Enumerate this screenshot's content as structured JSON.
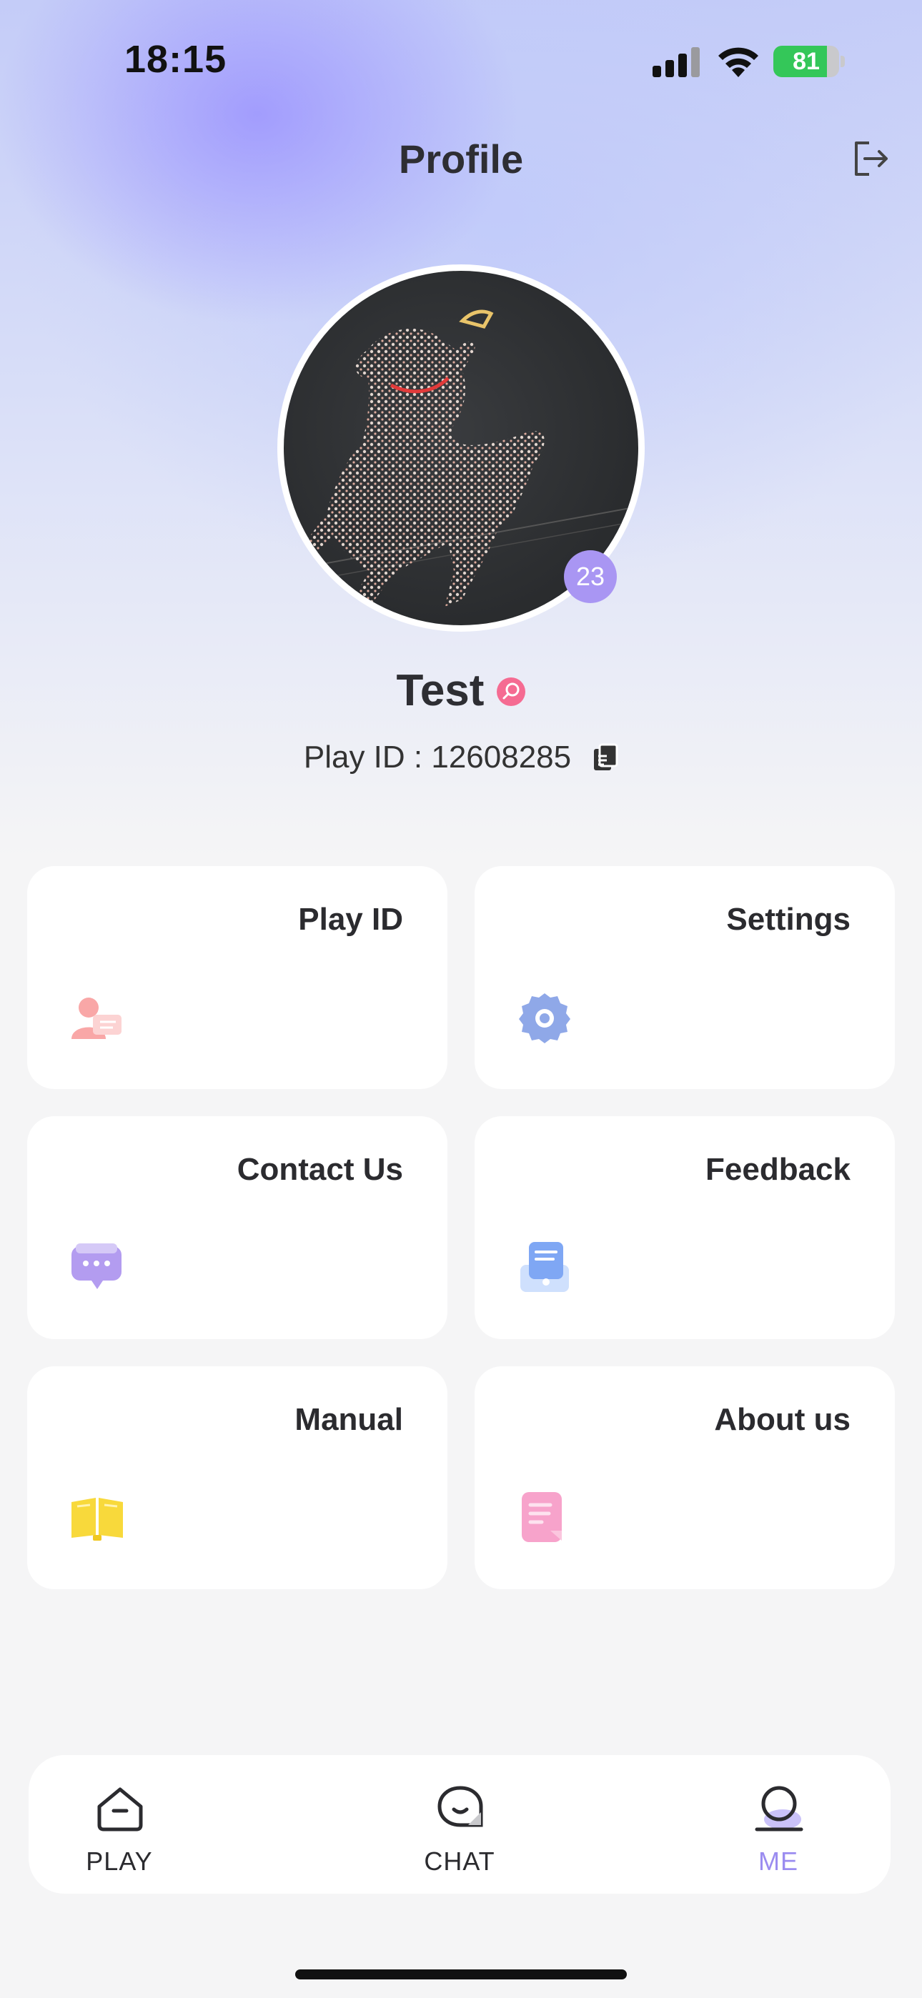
{
  "status_bar": {
    "time": "18:15",
    "battery_level": "81",
    "battery_percent": 81
  },
  "header": {
    "title": "Profile",
    "logout_icon": "logout-icon"
  },
  "profile": {
    "name": "Test",
    "level": "23",
    "play_id_text": "Play ID : 12608285",
    "avatar_icon": "user-avatar",
    "copy_icon": "copy-icon"
  },
  "menu": {
    "items": [
      {
        "label": "Play ID",
        "icon": "id-card-icon",
        "color": "#f9a7a7"
      },
      {
        "label": "Settings",
        "icon": "gear-icon",
        "color": "#8fa8e8"
      },
      {
        "label": "Contact Us",
        "icon": "chat-bubble-icon",
        "color": "#b39cf0"
      },
      {
        "label": "Feedback",
        "icon": "feedback-icon",
        "color": "#7fa7f4"
      },
      {
        "label": "Manual",
        "icon": "book-icon",
        "color": "#f8d93b"
      },
      {
        "label": "About us",
        "icon": "document-icon",
        "color": "#f7a3cb"
      }
    ]
  },
  "tabbar": {
    "items": [
      {
        "label": "PLAY",
        "icon": "play-home-icon",
        "active": false
      },
      {
        "label": "CHAT",
        "icon": "chat-icon",
        "active": false
      },
      {
        "label": "ME",
        "icon": "me-icon",
        "active": true
      }
    ]
  },
  "colors": {
    "accent": "#9b8cf0",
    "battery_green": "#34c759",
    "badge_pink": "#f56b92"
  }
}
